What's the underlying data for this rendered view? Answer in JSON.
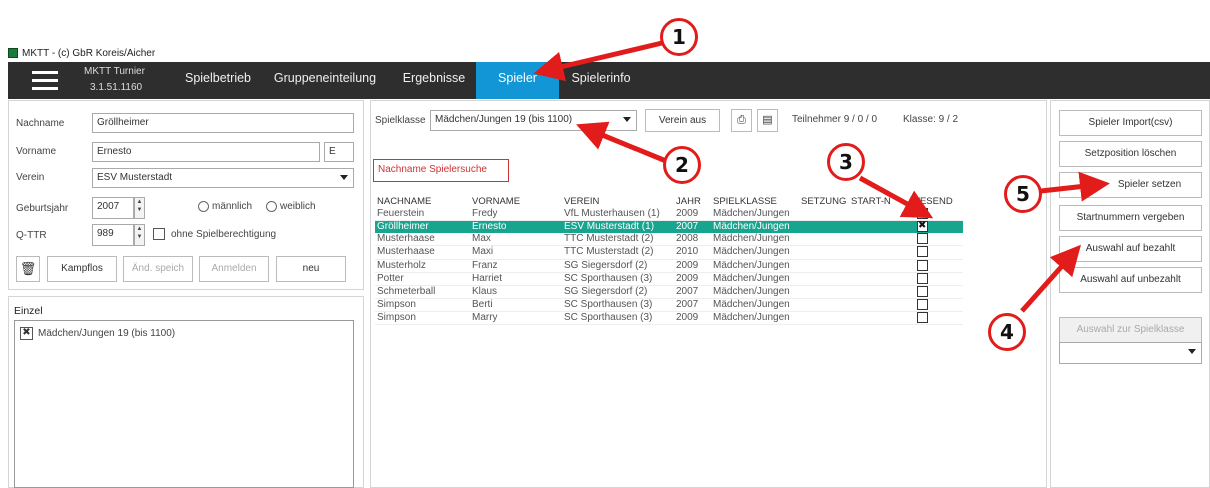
{
  "window": {
    "title": "MKTT - (c) GbR Koreis/Aicher"
  },
  "nav": {
    "app_name": "MKTT Turnier",
    "app_version": "3.1.51.1160",
    "tabs": [
      "Spielbetrieb",
      "Gruppeneinteilung",
      "Ergebnisse",
      "Spieler",
      "Spielerinfo"
    ],
    "active_tab": "Spieler"
  },
  "form": {
    "nachname_label": "Nachname",
    "nachname_value": "Gröllheimer",
    "vorname_label": "Vorname",
    "vorname_value": "Ernesto",
    "vorname_initial": "E",
    "verein_label": "Verein",
    "verein_value": "ESV Musterstadt",
    "geburtsjahr_label": "Geburtsjahr",
    "geburtsjahr_value": "2007",
    "male_label": "männlich",
    "female_label": "weiblich",
    "qttr_label": "Q-TTR",
    "qttr_value": "989",
    "ohne_label": "ohne Spielberechtigung",
    "btn_kampflos": "Kampflos",
    "btn_aend": "Änd. speich",
    "btn_anmelden": "Anmelden",
    "btn_neu": "neu"
  },
  "einzel": {
    "title": "Einzel",
    "items": [
      "Mädchen/Jungen 19 (bis 1100)"
    ]
  },
  "filter": {
    "spielklasse_label": "Spielklasse",
    "spielklasse_value": "Mädchen/Jungen 19 (bis 1100)",
    "verein_aus": "Verein aus",
    "teilnehmer": "Teilnehmer  9 / 0 / 0",
    "klasse": "Klasse:  9 / 2",
    "search_placeholder": "Nachname Spielersuche"
  },
  "table": {
    "headers": [
      "NACHNAME",
      "VORNAME",
      "VEREIN",
      "JAHR",
      "SPIELKLASSE",
      "SETZUNG",
      "START-N",
      "WESEND"
    ],
    "rows": [
      {
        "nachname": "Feuerstein",
        "vorname": "Fredy",
        "verein": "VfL Musterhausen (1)",
        "jahr": "2009",
        "klasse": "Mädchen/Jungen",
        "anwesend": true,
        "selected": false
      },
      {
        "nachname": "Gröllheimer",
        "vorname": "Ernesto",
        "verein": "ESV Musterstadt (1)",
        "jahr": "2007",
        "klasse": "Mädchen/Jungen",
        "anwesend": true,
        "selected": true
      },
      {
        "nachname": "Musterhaase",
        "vorname": "Max",
        "verein": "TTC Musterstadt (2)",
        "jahr": "2008",
        "klasse": "Mädchen/Jungen",
        "anwesend": false,
        "selected": false
      },
      {
        "nachname": "Musterhaase",
        "vorname": "Maxi",
        "verein": "TTC Musterstadt (2)",
        "jahr": "2010",
        "klasse": "Mädchen/Jungen",
        "anwesend": false,
        "selected": false
      },
      {
        "nachname": "Musterholz",
        "vorname": "Franz",
        "verein": "SG Siegersdorf (2)",
        "jahr": "2009",
        "klasse": "Mädchen/Jungen",
        "anwesend": false,
        "selected": false
      },
      {
        "nachname": "Potter",
        "vorname": "Harriet",
        "verein": "SC Sporthausen (3)",
        "jahr": "2009",
        "klasse": "Mädchen/Jungen",
        "anwesend": false,
        "selected": false
      },
      {
        "nachname": "Schmeterball",
        "vorname": "Klaus",
        "verein": "SG Siegersdorf (2)",
        "jahr": "2007",
        "klasse": "Mädchen/Jungen",
        "anwesend": false,
        "selected": false
      },
      {
        "nachname": "Simpson",
        "vorname": "Berti",
        "verein": "SC Sporthausen (3)",
        "jahr": "2007",
        "klasse": "Mädchen/Jungen",
        "anwesend": false,
        "selected": false
      },
      {
        "nachname": "Simpson",
        "vorname": "Marry",
        "verein": "SC Sporthausen (3)",
        "jahr": "2009",
        "klasse": "Mädchen/Jungen",
        "anwesend": false,
        "selected": false
      }
    ]
  },
  "actions": {
    "import": "Spieler Import(csv)",
    "setzpos": "Setzposition löschen",
    "setzen": "Spieler setzen",
    "startnr": "Startnummern vergeben",
    "bezahlt": "Auswahl auf bezahlt",
    "unbezahlt": "Auswahl auf unbezahlt",
    "zur_klasse": "Auswahl zur Spielklasse"
  },
  "callouts": [
    "1",
    "2",
    "3",
    "4",
    "5"
  ],
  "colors": {
    "nav_bg": "#2e2e2e",
    "active_tab": "#1296d6",
    "selected_row": "#17a58f",
    "annotation": "#e21b1b"
  }
}
